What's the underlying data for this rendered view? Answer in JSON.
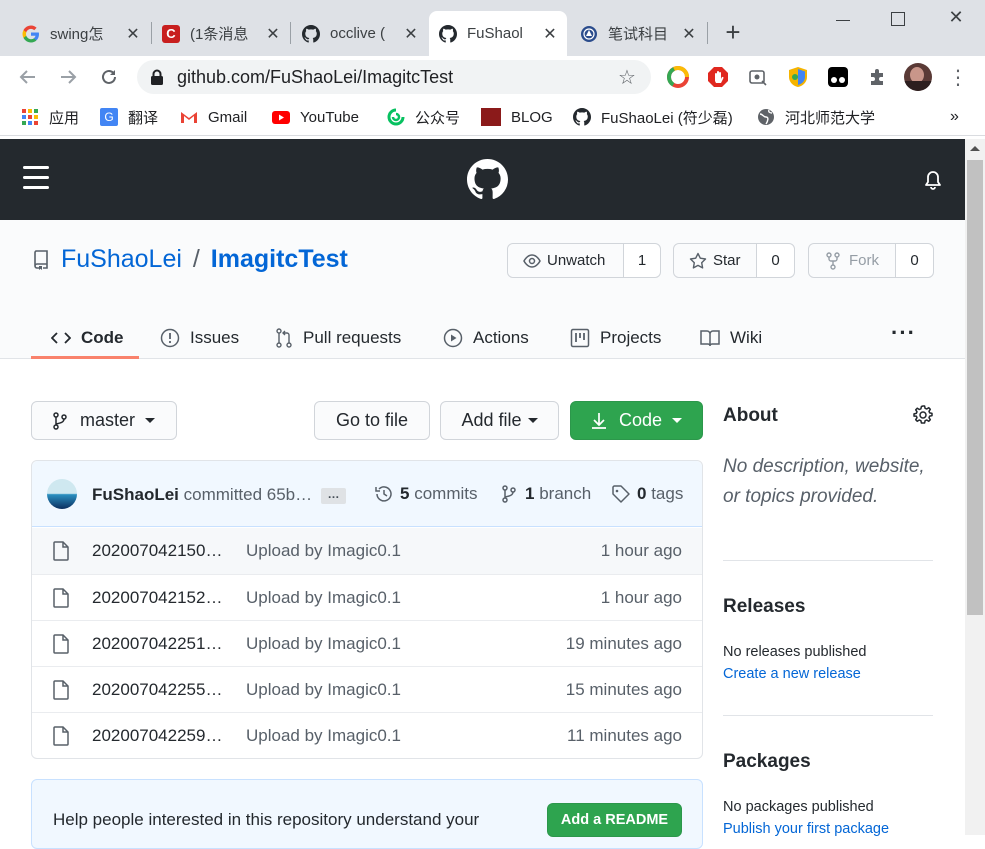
{
  "browser": {
    "tabs": [
      {
        "title": "swing怎",
        "icon": "google-icon"
      },
      {
        "title": "(1条消息",
        "icon": "csdn-icon"
      },
      {
        "title": "occlive (",
        "icon": "github-icon"
      },
      {
        "title": "FuShaol",
        "icon": "github-icon",
        "active": true
      },
      {
        "title": "笔试科目",
        "icon": "school-icon"
      }
    ],
    "new_tab": "+",
    "url": "github.com/FuShaoLei/ImagitcTest",
    "bookmarks": [
      {
        "label": "应用",
        "icon": "apps-icon"
      },
      {
        "label": "翻译",
        "icon": "translate-icon"
      },
      {
        "label": "Gmail",
        "icon": "gmail-icon"
      },
      {
        "label": "YouTube",
        "icon": "youtube-icon"
      },
      {
        "label": "公众号",
        "icon": "wechat-icon"
      },
      {
        "label": "BLOG",
        "icon": "blog-icon"
      },
      {
        "label": "FuShaoLei (符少磊)",
        "icon": "github-icon"
      },
      {
        "label": "河北师范大学",
        "icon": "globe-icon"
      }
    ],
    "more_bookmarks": "»"
  },
  "repo": {
    "owner": "FuShaoLei",
    "separator": "/",
    "name": "ImagitcTest",
    "watch_label": "Unwatch",
    "watch_count": "1",
    "star_label": "Star",
    "star_count": "0",
    "fork_label": "Fork",
    "fork_count": "0",
    "tabs": [
      "Code",
      "Issues",
      "Pull requests",
      "Actions",
      "Projects",
      "Wiki"
    ],
    "more": "···"
  },
  "toolbar": {
    "branch": "master",
    "go_to_file": "Go to file",
    "add_file": "Add file",
    "code": "Code"
  },
  "commit": {
    "author": "FuShaoLei",
    "message": "committed 65b…",
    "ellipsis": "…",
    "commits_count": "5",
    "commits_label": "commits",
    "branch_count": "1",
    "branch_label": "branch",
    "tags_count": "0",
    "tags_label": "tags"
  },
  "files": [
    {
      "name": "202007042150…",
      "message": "Upload by Imagic0.1",
      "age": "1 hour ago"
    },
    {
      "name": "202007042152…",
      "message": "Upload by Imagic0.1",
      "age": "1 hour ago"
    },
    {
      "name": "202007042251…",
      "message": "Upload by Imagic0.1",
      "age": "19 minutes ago"
    },
    {
      "name": "202007042255…",
      "message": "Upload by Imagic0.1",
      "age": "15 minutes ago"
    },
    {
      "name": "202007042259…",
      "message": "Upload by Imagic0.1",
      "age": "11 minutes ago"
    }
  ],
  "readme": {
    "text": "Help people interested in this repository understand your",
    "button": "Add a README"
  },
  "sidebar": {
    "about_title": "About",
    "about_text": "No description, website, or topics provided.",
    "releases_title": "Releases",
    "releases_text": "No releases published",
    "releases_link": "Create a new release",
    "packages_title": "Packages",
    "packages_text": "No packages published",
    "packages_link": "Publish your first package"
  },
  "colors": {
    "header_bg": "#24292e",
    "link": "#0366d6",
    "green": "#2ea44f",
    "tab_underline": "#f9826c"
  }
}
